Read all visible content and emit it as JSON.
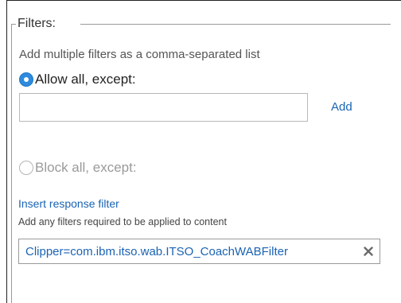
{
  "filters": {
    "legend": "Filters:",
    "helper_text": "Add multiple filters as a comma-separated list",
    "allow_option_label": "Allow all, except:",
    "allow_option_selected": true,
    "filter_input_value": "",
    "filter_input_placeholder": "",
    "add_label": "Add",
    "block_option_label": "Block all, except:",
    "block_option_selected": false
  },
  "response_filter": {
    "insert_link_label": "Insert response filter",
    "helper_text": "Add any filters required to be applied to content",
    "tags": [
      {
        "label": "Clipper=com.ibm.itso.wab.ITSO_CoachWABFilter",
        "remove_icon": "close-x-icon"
      }
    ]
  },
  "colors": {
    "link": "#1a63b3",
    "radio_selected": "#2e8bde",
    "disabled_text": "#9a9a9a",
    "border": "#b8b8b8"
  }
}
